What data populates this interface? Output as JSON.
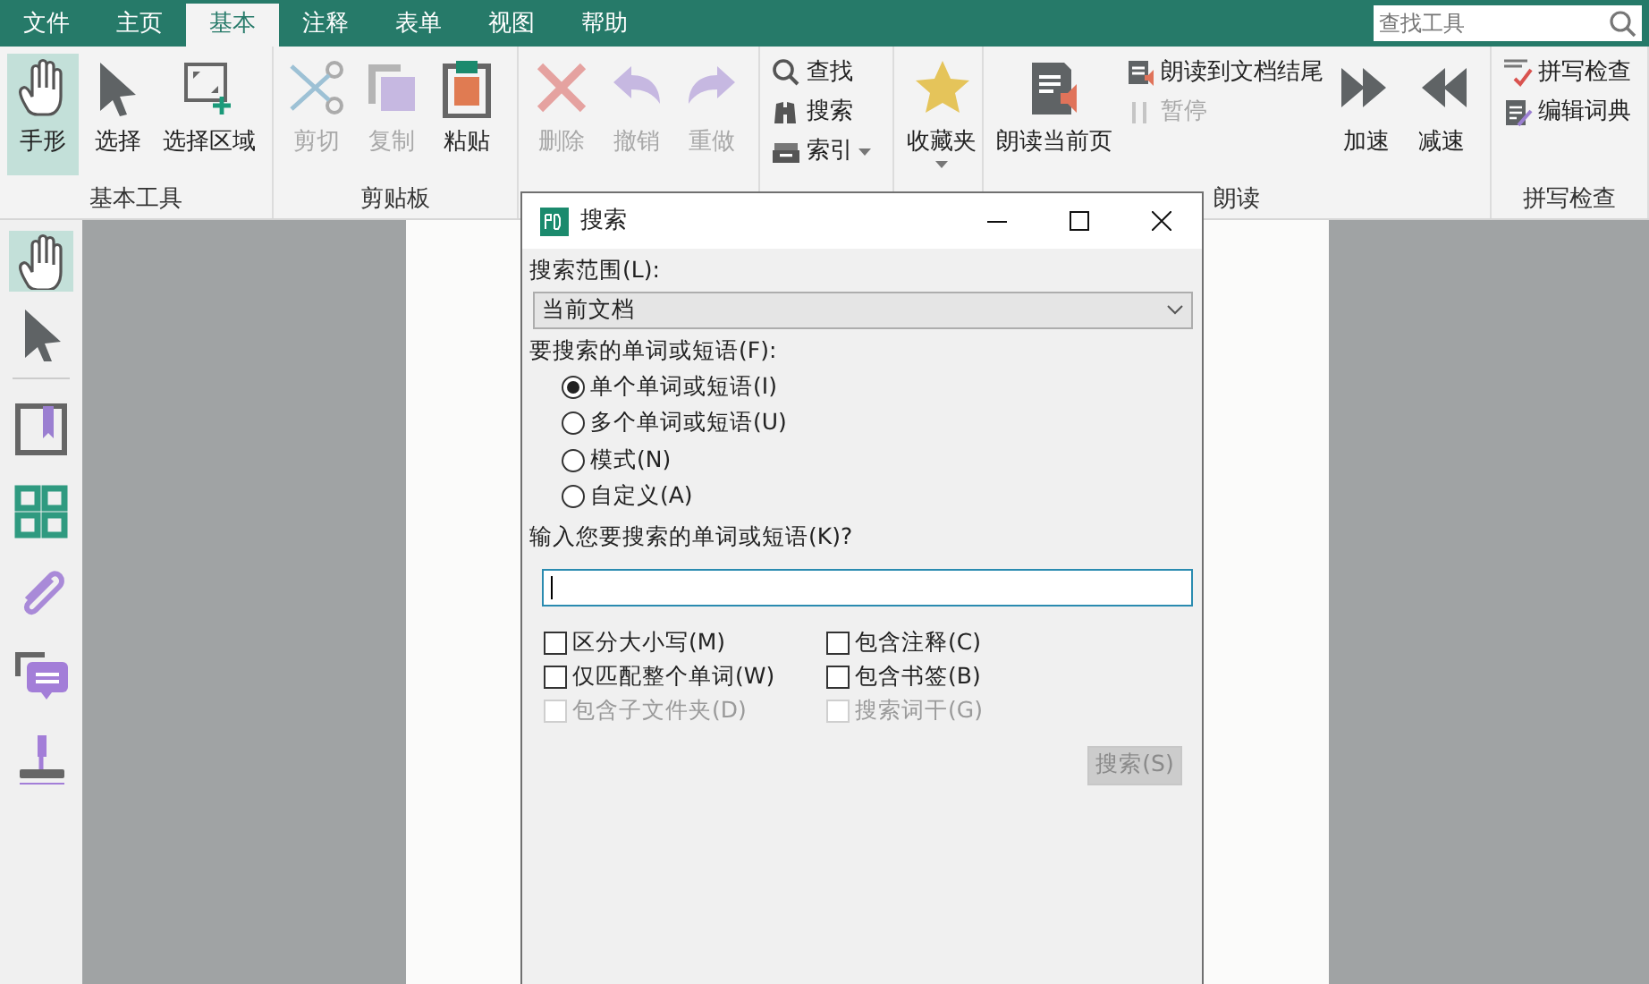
{
  "menu_tabs": [
    {
      "label": "文件",
      "selected": false
    },
    {
      "label": "主页",
      "selected": false
    },
    {
      "label": "基本",
      "selected": true
    },
    {
      "label": "注释",
      "selected": false
    },
    {
      "label": "表单",
      "selected": false
    },
    {
      "label": "视图",
      "selected": false
    },
    {
      "label": "帮助",
      "selected": false
    }
  ],
  "tool_search": {
    "placeholder": "查找工具"
  },
  "ribbon_groups": [
    {
      "label": "基本工具",
      "items": [
        {
          "kind": "large",
          "label": "手形",
          "selected": true,
          "disabled": false
        },
        {
          "kind": "large",
          "label": "选择",
          "selected": false,
          "disabled": false
        },
        {
          "kind": "large",
          "label": "选择区域",
          "selected": false,
          "disabled": false
        }
      ]
    },
    {
      "label": "剪贴板",
      "items": [
        {
          "kind": "large",
          "label": "剪切",
          "selected": false,
          "disabled": true
        },
        {
          "kind": "large",
          "label": "复制",
          "selected": false,
          "disabled": true
        },
        {
          "kind": "large",
          "label": "粘贴",
          "selected": false,
          "disabled": false
        }
      ]
    },
    {
      "items": [
        {
          "kind": "large",
          "label": "删除",
          "selected": false,
          "disabled": true
        },
        {
          "kind": "large",
          "label": "撤销",
          "selected": false,
          "disabled": true
        },
        {
          "kind": "large",
          "label": "重做",
          "selected": false,
          "disabled": true
        }
      ]
    },
    {
      "items": [
        {
          "kind": "small",
          "label": "查找",
          "selected": false,
          "disabled": false,
          "dropdown": false
        },
        {
          "kind": "small",
          "label": "搜索",
          "selected": false,
          "disabled": false,
          "dropdown": false
        },
        {
          "kind": "small",
          "label": "索引",
          "selected": false,
          "disabled": false,
          "dropdown": true
        }
      ]
    },
    {
      "items": [
        {
          "kind": "large",
          "label": "收藏夹",
          "selected": false,
          "disabled": false,
          "dropdown": true
        }
      ]
    },
    {
      "label": "朗读",
      "items": [
        {
          "kind": "large",
          "label": "朗读当前页",
          "selected": false,
          "disabled": false
        },
        {
          "kind": "small",
          "label": "朗读到文档结尾",
          "selected": false,
          "disabled": false
        },
        {
          "kind": "small",
          "label": "暂停",
          "selected": false,
          "disabled": true
        },
        {
          "kind": "large",
          "label": "加速",
          "selected": false,
          "disabled": false
        },
        {
          "kind": "large",
          "label": "减速",
          "selected": false,
          "disabled": false
        }
      ]
    },
    {
      "label": "拼写检查",
      "items": [
        {
          "kind": "small",
          "label": "拼写检查",
          "selected": false,
          "disabled": false
        },
        {
          "kind": "small",
          "label": "编辑词典",
          "selected": false,
          "disabled": false
        }
      ]
    }
  ],
  "sidebar": {
    "tools": [
      {
        "selected": true
      },
      {
        "selected": false
      }
    ]
  },
  "dialog": {
    "title": "搜索",
    "scope_label": "搜索范围(L):",
    "scope_value": "当前文档",
    "phrase_label": "要搜索的单词或短语(F):",
    "modes": [
      {
        "label": "单个单词或短语(I)",
        "selected": true
      },
      {
        "label": "多个单词或短语(U)",
        "selected": false
      },
      {
        "label": "模式(N)",
        "selected": false
      },
      {
        "label": "自定义(A)",
        "selected": false
      }
    ],
    "input_label": "输入您要搜索的单词或短语(K)?",
    "focused": true,
    "options": [
      {
        "label": "区分大小写(M)",
        "checked": false,
        "disabled": false
      },
      {
        "label": "包含注释(C)",
        "checked": false,
        "disabled": false
      },
      {
        "label": "仅匹配整个单词(W)",
        "checked": false,
        "disabled": false
      },
      {
        "label": "包含书签(B)",
        "checked": false,
        "disabled": false
      },
      {
        "label": "包含子文件夹(D)",
        "checked": false,
        "disabled": true
      },
      {
        "label": "搜索词干(G)",
        "checked": false,
        "disabled": true
      }
    ],
    "search_button": {
      "label": "搜索(S)",
      "disabled": true
    }
  }
}
